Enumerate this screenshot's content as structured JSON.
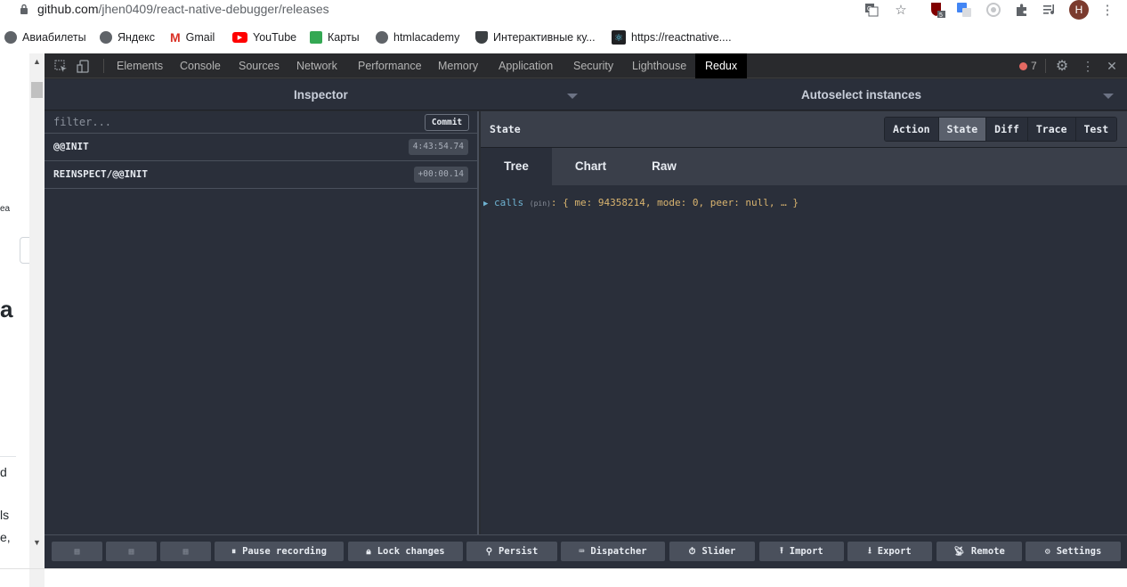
{
  "browser": {
    "url_host": "github.com",
    "url_path": "/jhen0409/react-native-debugger/releases",
    "avatar_letter": "H",
    "ext_badge": "5",
    "bookmarks": [
      {
        "label": "Авиабилеты",
        "icon": "globe-icon",
        "color": "#5f6368"
      },
      {
        "label": "Яндекс",
        "icon": "globe-icon",
        "color": "#5f6368"
      },
      {
        "label": "Gmail",
        "icon": "gmail-icon",
        "color": "#d93025"
      },
      {
        "label": "YouTube",
        "icon": "youtube-icon",
        "color": "#ff0000"
      },
      {
        "label": "Карты",
        "icon": "maps-icon",
        "color": "#34a853"
      },
      {
        "label": "htmlacademy",
        "icon": "globe-icon",
        "color": "#5f6368"
      },
      {
        "label": "Интерактивные ку...",
        "icon": "shield-icon",
        "color": "#3c4043"
      },
      {
        "label": "https://reactnative....",
        "icon": "react-icon",
        "color": "#202124"
      }
    ]
  },
  "page_fragments": {
    "line1": "ea",
    "line2": "a",
    "line3": "d",
    "line4": "ls",
    "line5": "e,"
  },
  "devtools": {
    "tabs": [
      "Elements",
      "Console",
      "Sources",
      "Network",
      "Performance",
      "Memory",
      "Application",
      "Security",
      "Lighthouse",
      "Redux"
    ],
    "active_tab": "Redux",
    "error_count": "7"
  },
  "redux": {
    "inspector_title": "Inspector",
    "instances_title": "Autoselect instances",
    "filter_placeholder": "filter...",
    "commit_label": "Commit",
    "actions": [
      {
        "name": "@@INIT",
        "time": "4:43:54.74"
      },
      {
        "name": "REINSPECT/@@INIT",
        "time": "+00:00.14"
      }
    ],
    "state_title": "State",
    "monitor_tabs": [
      "Action",
      "State",
      "Diff",
      "Trace",
      "Test"
    ],
    "active_monitor_tab": "State",
    "view_tabs": [
      "Tree",
      "Chart",
      "Raw"
    ],
    "active_view_tab": "Tree",
    "tree": {
      "key": "calls",
      "hint": "(pin)",
      "value": ": { me: 94358214, mode: 0, peer: null, … }"
    },
    "toolbar": {
      "pause": "Pause recording",
      "lock": "Lock changes",
      "persist": "Persist",
      "dispatcher": "Dispatcher",
      "slider": "Slider",
      "import": "Import",
      "export": "Export",
      "remote": "Remote",
      "settings": "Settings"
    }
  }
}
